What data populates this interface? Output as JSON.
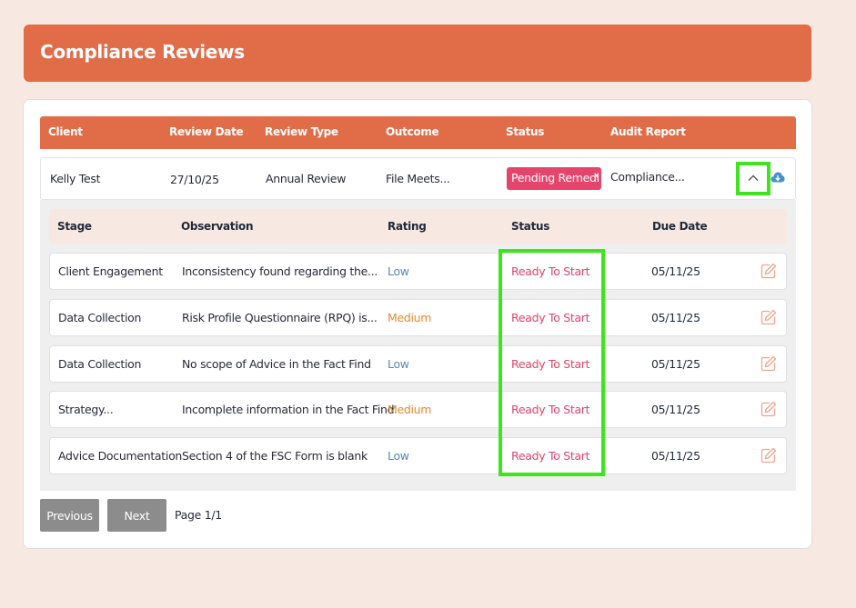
{
  "header": {
    "title": "Compliance Reviews"
  },
  "table": {
    "columns": [
      "Client",
      "Review Date",
      "Review Type",
      "Outcome",
      "Status",
      "Audit Report"
    ],
    "row": {
      "client": "Kelly Test",
      "review_date": "27/10/25",
      "review_type": "Annual Review",
      "outcome": "File Meets...",
      "status": "Pending Remedi",
      "audit_report": "Compliance..."
    }
  },
  "details": {
    "columns": [
      "Stage",
      "Observation",
      "Rating",
      "Status",
      "Due Date"
    ],
    "rows": [
      {
        "stage": "Client Engagement",
        "observation": "Inconsistency found regarding the...",
        "rating": "Low",
        "status": "Ready To Start",
        "due": "05/11/25"
      },
      {
        "stage": "Data Collection",
        "observation": "Risk Profile Questionnaire (RPQ) is...",
        "rating": "Medium",
        "status": "Ready To Start",
        "due": "05/11/25"
      },
      {
        "stage": "Data Collection",
        "observation": "No scope of Advice in the Fact Find",
        "rating": "Low",
        "status": "Ready To Start",
        "due": "05/11/25"
      },
      {
        "stage": "Strategy...",
        "observation": "Incomplete information in the Fact Find",
        "rating": "Medium",
        "status": "Ready To Start",
        "due": "05/11/25"
      },
      {
        "stage": "Advice Documentation",
        "observation": "Section 4 of the FSC Form is blank",
        "rating": "Low",
        "status": "Ready To Start",
        "due": "05/11/25"
      }
    ]
  },
  "pagination": {
    "previous": "Previous",
    "next": "Next",
    "page": "Page 1/1"
  },
  "colors": {
    "accent": "#e06c48",
    "status_badge": "#e5456b",
    "highlight": "#3ee51e"
  }
}
